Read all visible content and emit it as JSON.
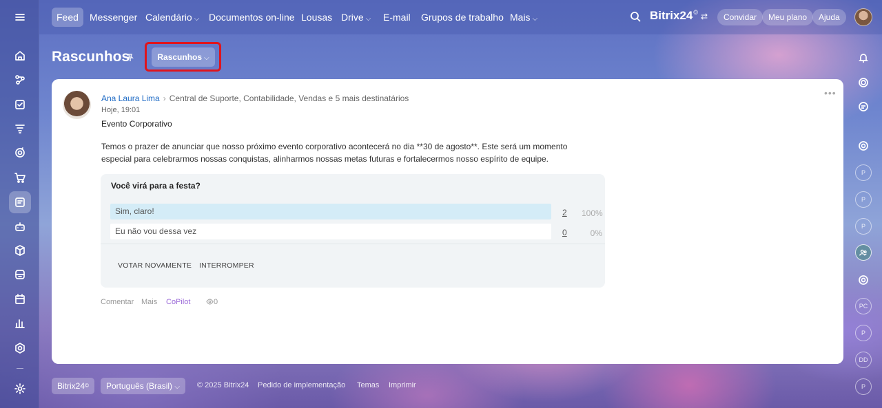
{
  "nav": {
    "items": [
      {
        "label": "Feed"
      },
      {
        "label": "Messenger"
      },
      {
        "label": "Calendário"
      },
      {
        "label": "Documentos on-line"
      },
      {
        "label": "Lousas"
      },
      {
        "label": "Drive"
      },
      {
        "label": "E-mail"
      },
      {
        "label": "Grupos de trabalho"
      },
      {
        "label": "Mais"
      }
    ],
    "brand": "Bitrix24",
    "brand_sup": "©",
    "invite_label": "Convidar",
    "plan_label": "Meu plano",
    "help_label": "Ajuda"
  },
  "header": {
    "title": "Rascunhos",
    "filter_label": "Rascunhos"
  },
  "post": {
    "author": "Ana Laura Lima",
    "recipients": "Central de Suporte, Contabilidade, Vendas   e 5 mais destinatários",
    "time": "Hoje, 19:01",
    "title": "Evento Corporativo",
    "body": "Temos o prazer de anunciar que nosso próximo evento corporativo acontecerá no dia **30 de agosto**. Este será um momento especial para celebrarmos nossas conquistas, alinharmos nossas metas futuras e fortalecermos nosso espírito de equipe.",
    "poll": {
      "question": "Você virá para a festa?",
      "options": [
        {
          "label": "Sim, claro!",
          "count": "2",
          "percent": "100%",
          "fraction": 1.0
        },
        {
          "label": "Eu não vou dessa vez",
          "count": "0",
          "percent": "0%",
          "fraction": 0.0
        }
      ],
      "vote_again": "VOTAR NOVAMENTE",
      "stop": "INTERROMPER"
    },
    "footer": {
      "comment": "Comentar",
      "more": "Mais",
      "copilot": "CoPilot",
      "views": "0"
    }
  },
  "right_rail": {
    "avatars": [
      "P",
      "P",
      "P",
      "PC",
      "P",
      "DD",
      "P"
    ]
  },
  "bottom": {
    "brand": "Bitrix24",
    "brand_sup": "©",
    "language": "Português (Brasil)",
    "copyright": "© 2025 Bitrix24",
    "implementation": "Pedido de implementação",
    "themes": "Temas",
    "print": "Imprimir"
  }
}
